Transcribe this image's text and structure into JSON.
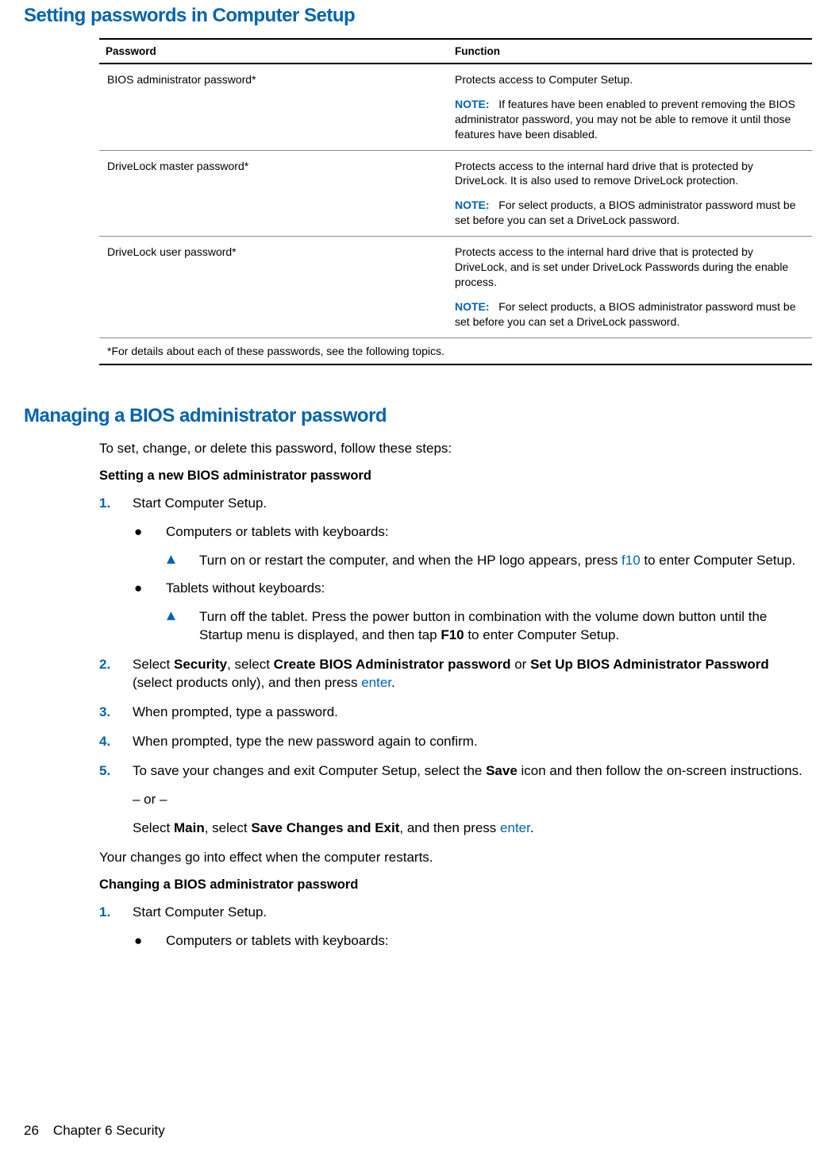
{
  "heading1": "Setting passwords in Computer Setup",
  "table": {
    "head": {
      "password": "Password",
      "function": "Function"
    },
    "rows": [
      {
        "pw": "BIOS administrator password*",
        "fn": "Protects access to Computer Setup.",
        "noteLabel": "NOTE:",
        "note": "If features have been enabled to prevent removing the BIOS administrator password, you may not be able to remove it until those features have been disabled."
      },
      {
        "pw": "DriveLock master password*",
        "fn": "Protects access to the internal hard drive that is protected by DriveLock. It is also used to remove DriveLock protection.",
        "noteLabel": "NOTE:",
        "note": "For select products, a BIOS administrator password must be set before you can set a DriveLock password."
      },
      {
        "pw": "DriveLock user password*",
        "fn": "Protects access to the internal hard drive that is protected by DriveLock, and is set under DriveLock Passwords during the enable process.",
        "noteLabel": "NOTE:",
        "note": "For select products, a BIOS administrator password must be set before you can set a DriveLock password."
      }
    ],
    "footnote": "*For details about each of these passwords, see the following topics."
  },
  "heading2": "Managing a BIOS administrator password",
  "intro": "To set, change, or delete this password, follow these steps:",
  "setNewTitle": "Setting a new BIOS administrator password",
  "steps": {
    "s1": {
      "num": "1.",
      "text": "Start Computer Setup.",
      "b1": "Computers or tablets with keyboards:",
      "t1a": "Turn on or restart the computer, and when the HP logo appears, press ",
      "t1key": "f10",
      "t1b": " to enter Computer Setup.",
      "b2": "Tablets without keyboards:",
      "t2a": "Turn off the tablet. Press the power button in combination with the volume down button until the Startup menu is displayed, and then tap ",
      "t2bold": "F10",
      "t2b": " to enter Computer Setup."
    },
    "s2": {
      "num": "2.",
      "a": "Select ",
      "b1": "Security",
      "c": ", select ",
      "b2": "Create BIOS Administrator password",
      "d": " or ",
      "b3": "Set Up BIOS Administrator Password",
      "e": " (select products only), and then press ",
      "key": "enter",
      "f": "."
    },
    "s3": {
      "num": "3.",
      "text": "When prompted, type a password."
    },
    "s4": {
      "num": "4.",
      "text": "When prompted, type the new password again to confirm."
    },
    "s5": {
      "num": "5.",
      "a": "To save your changes and exit Computer Setup, select the ",
      "b1": "Save",
      "b": " icon and then follow the on-screen instructions.",
      "or": "– or –",
      "c": "Select ",
      "b2": "Main",
      "d": ", select ",
      "b3": "Save Changes and Exit",
      "e": ", and then press ",
      "key": "enter",
      "f": "."
    }
  },
  "outro": "Your changes go into effect when the computer restarts.",
  "changeTitle": "Changing a BIOS administrator password",
  "change": {
    "s1num": "1.",
    "s1text": "Start Computer Setup.",
    "b1": "Computers or tablets with keyboards:"
  },
  "footer": {
    "page": "26",
    "chapter": "Chapter 6   Security"
  }
}
